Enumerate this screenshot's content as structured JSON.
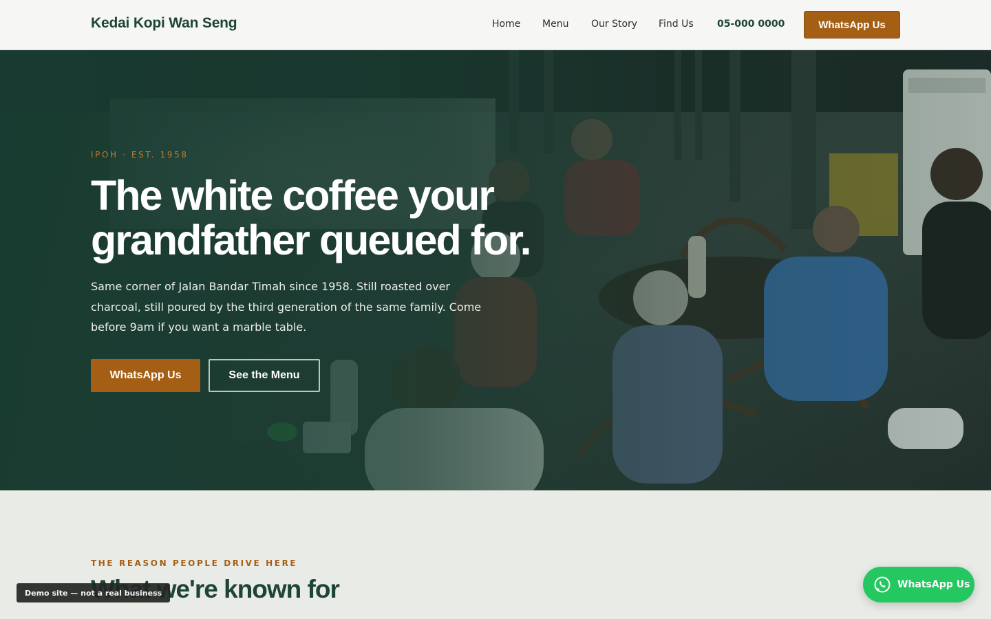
{
  "header": {
    "brand": "Kedai Kopi Wan Seng",
    "nav": [
      "Home",
      "Menu",
      "Our Story",
      "Find Us"
    ],
    "phone": "05-000 0000",
    "cta_label": "WhatsApp Us"
  },
  "hero": {
    "eyebrow": "IPOH · EST. 1958",
    "headline_line1": "The white coffee your",
    "headline_line2": "grandfather queued for.",
    "lede": "Same corner of Jalan Bandar Timah since 1958. Still roasted over charcoal, still poured by the third generation of the same family. Come before 9am if you want a marble table.",
    "primary_label": "WhatsApp Us",
    "secondary_label": "See the Menu"
  },
  "section": {
    "eyebrow": "THE REASON PEOPLE DRIVE HERE",
    "title": "What we're known for"
  },
  "demo_badge": "Demo site — not a real business",
  "floating_whatsapp": {
    "label": "WhatsApp Us",
    "icon": "whatsapp-icon"
  },
  "colors": {
    "brand_green": "#1d4436",
    "accent_amber": "#a55f14",
    "whatsapp_green": "#25c760",
    "page_background": "#e9ebe6"
  }
}
